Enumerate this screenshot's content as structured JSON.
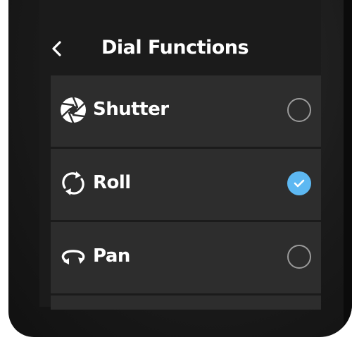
{
  "header": {
    "title": "Dial Functions",
    "back_icon": "chevron-left-icon"
  },
  "options": [
    {
      "label": "Shutter",
      "icon": "aperture-icon",
      "selected": false
    },
    {
      "label": "Roll",
      "icon": "roll-rotate-icon",
      "selected": true
    },
    {
      "label": "Pan",
      "icon": "pan-rotate-icon",
      "selected": false
    }
  ],
  "colors": {
    "screen_bg": "#1b1b1b",
    "item_bg": "#2d2d2d",
    "accent": "#5db8f2",
    "text": "#ffffff",
    "radio_border": "#9a9a9a"
  }
}
